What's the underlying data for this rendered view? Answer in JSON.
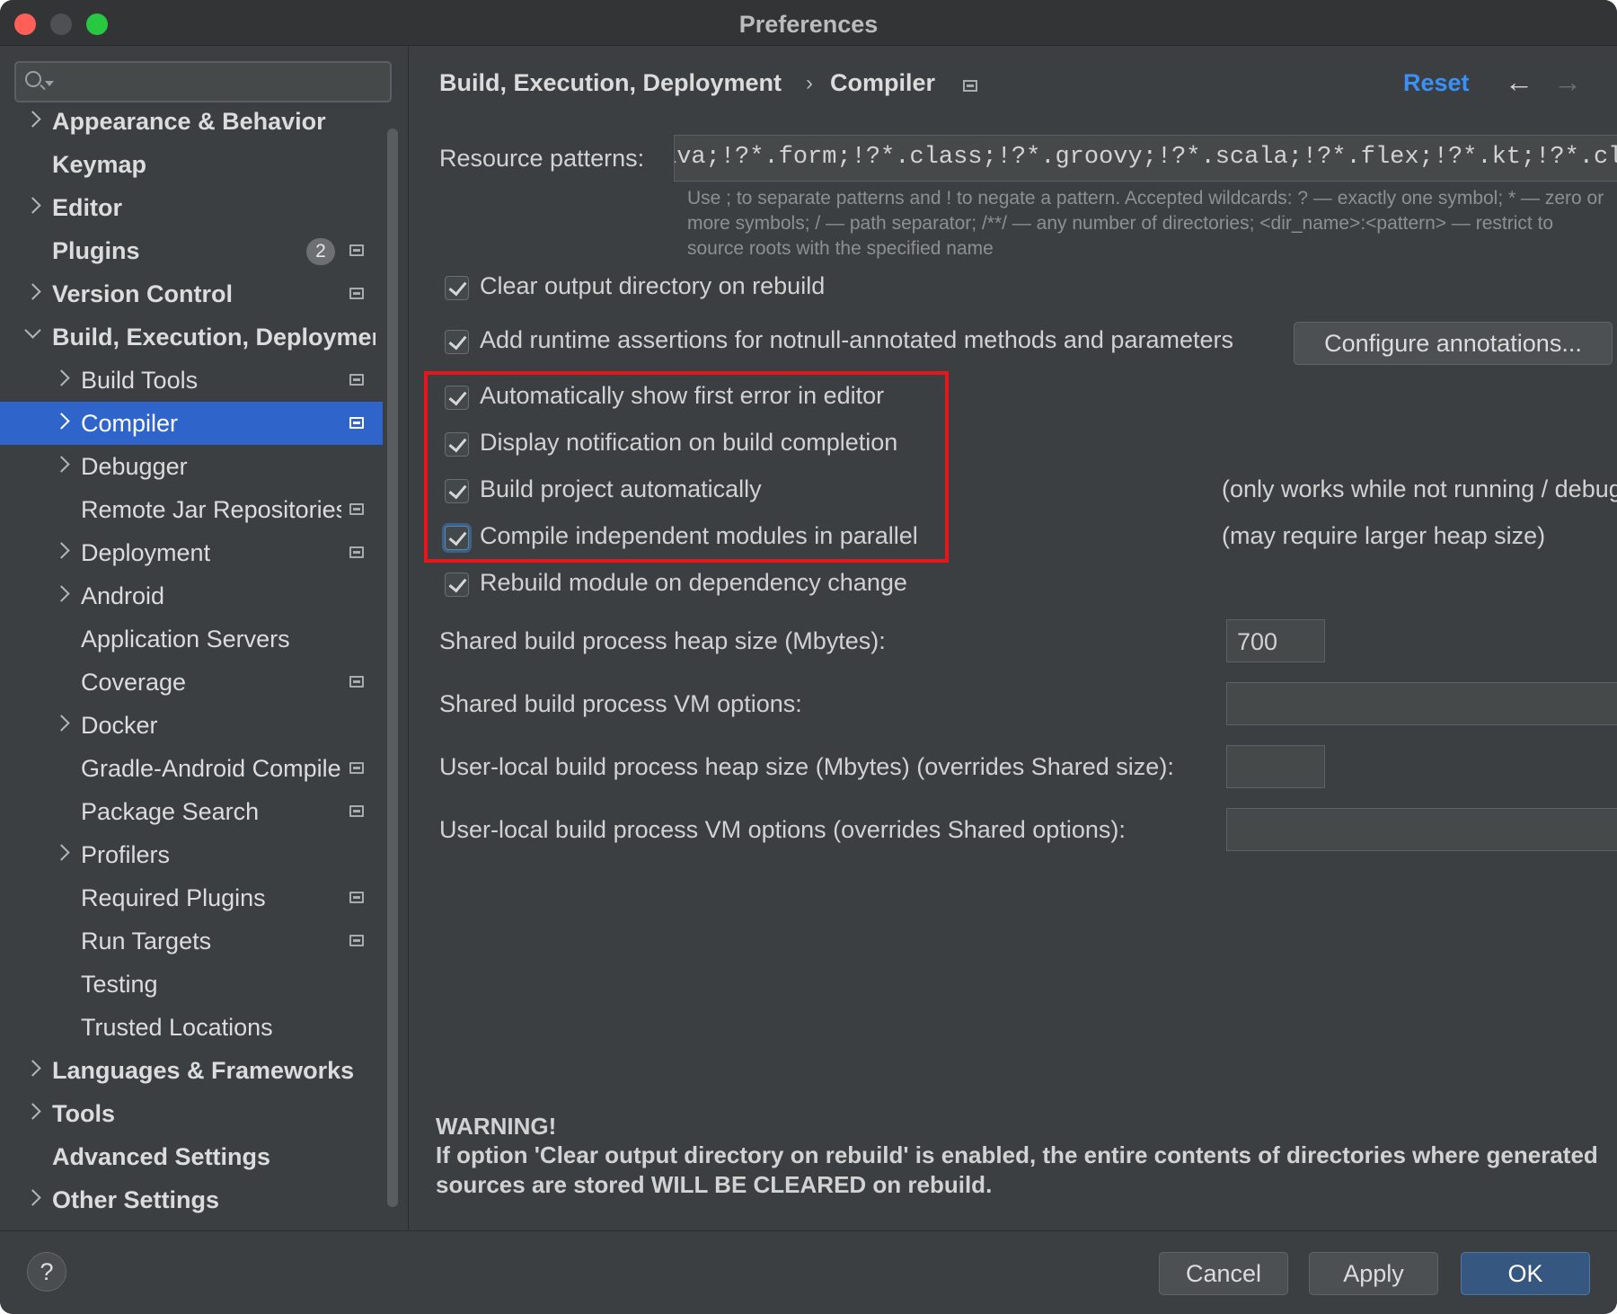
{
  "window": {
    "title": "Preferences"
  },
  "search": {
    "placeholder": ""
  },
  "sidebar": {
    "items": [
      {
        "label": "Appearance & Behavior",
        "expandable": "collapsed",
        "bold": true,
        "badge": "",
        "project_icon": false,
        "selected": false
      },
      {
        "label": "Keymap",
        "expandable": "none",
        "bold": true,
        "badge": "",
        "project_icon": false,
        "selected": false
      },
      {
        "label": "Editor",
        "expandable": "collapsed",
        "bold": true,
        "badge": "",
        "project_icon": false,
        "selected": false
      },
      {
        "label": "Plugins",
        "expandable": "none",
        "bold": true,
        "badge": "2",
        "project_icon": true,
        "selected": false
      },
      {
        "label": "Version Control",
        "expandable": "collapsed",
        "bold": true,
        "badge": "",
        "project_icon": true,
        "selected": false
      },
      {
        "label": "Build, Execution, Deployment",
        "expandable": "expanded",
        "bold": true,
        "badge": "",
        "project_icon": false,
        "selected": false
      },
      {
        "label": "Build Tools",
        "expandable": "collapsed",
        "bold": false,
        "badge": "",
        "project_icon": true,
        "selected": false
      },
      {
        "label": "Compiler",
        "expandable": "collapsed",
        "bold": false,
        "badge": "",
        "project_icon": true,
        "selected": true
      },
      {
        "label": "Debugger",
        "expandable": "collapsed",
        "bold": false,
        "badge": "",
        "project_icon": false,
        "selected": false
      },
      {
        "label": "Remote Jar Repositories",
        "expandable": "none",
        "bold": false,
        "badge": "",
        "project_icon": true,
        "selected": false
      },
      {
        "label": "Deployment",
        "expandable": "collapsed",
        "bold": false,
        "badge": "",
        "project_icon": true,
        "selected": false
      },
      {
        "label": "Android",
        "expandable": "collapsed",
        "bold": false,
        "badge": "",
        "project_icon": false,
        "selected": false
      },
      {
        "label": "Application Servers",
        "expandable": "none",
        "bold": false,
        "badge": "",
        "project_icon": false,
        "selected": false
      },
      {
        "label": "Coverage",
        "expandable": "none",
        "bold": false,
        "badge": "",
        "project_icon": true,
        "selected": false
      },
      {
        "label": "Docker",
        "expandable": "collapsed",
        "bold": false,
        "badge": "",
        "project_icon": false,
        "selected": false
      },
      {
        "label": "Gradle-Android Compiler",
        "expandable": "none",
        "bold": false,
        "badge": "",
        "project_icon": true,
        "selected": false
      },
      {
        "label": "Package Search",
        "expandable": "none",
        "bold": false,
        "badge": "",
        "project_icon": true,
        "selected": false
      },
      {
        "label": "Profilers",
        "expandable": "collapsed",
        "bold": false,
        "badge": "",
        "project_icon": false,
        "selected": false
      },
      {
        "label": "Required Plugins",
        "expandable": "none",
        "bold": false,
        "badge": "",
        "project_icon": true,
        "selected": false
      },
      {
        "label": "Run Targets",
        "expandable": "none",
        "bold": false,
        "badge": "",
        "project_icon": true,
        "selected": false
      },
      {
        "label": "Testing",
        "expandable": "none",
        "bold": false,
        "badge": "",
        "project_icon": false,
        "selected": false
      },
      {
        "label": "Trusted Locations",
        "expandable": "none",
        "bold": false,
        "badge": "",
        "project_icon": false,
        "selected": false
      },
      {
        "label": "Languages & Frameworks",
        "expandable": "collapsed",
        "bold": true,
        "badge": "",
        "project_icon": false,
        "selected": false
      },
      {
        "label": "Tools",
        "expandable": "collapsed",
        "bold": true,
        "badge": "",
        "project_icon": false,
        "selected": false
      },
      {
        "label": "Advanced Settings",
        "expandable": "none",
        "bold": true,
        "badge": "",
        "project_icon": false,
        "selected": false
      },
      {
        "label": "Other Settings",
        "expandable": "collapsed",
        "bold": true,
        "badge": "",
        "project_icon": false,
        "selected": false
      }
    ]
  },
  "header": {
    "breadcrumb_parent": "Build, Execution, Deployment",
    "breadcrumb_separator": "›",
    "breadcrumb_current": "Compiler",
    "reset_label": "Reset",
    "back_icon": "←",
    "forward_icon": "→"
  },
  "compiler": {
    "resource_patterns_label": "Resource patterns:",
    "resource_patterns_value": "!?*.java;!?*.form;!?*.class;!?*.groovy;!?*.scala;!?*.flex;!?*.kt;!?*.clj;!?*.aj",
    "hint_line1": "Use ; to separate patterns and ! to negate a pattern. Accepted wildcards: ? — exactly one symbol; * — zero or",
    "hint_line2": "more symbols; / — path separator; /**/ — any number of directories; <dir_name>:<pattern> — restrict to",
    "hint_line3": "source roots with the specified name",
    "options": [
      {
        "label": "Clear output directory on rebuild",
        "checked": true,
        "note": ""
      },
      {
        "label": "Add runtime assertions for notnull-annotated methods and parameters",
        "checked": true,
        "note": ""
      },
      {
        "label": "Automatically show first error in editor",
        "checked": true,
        "note": ""
      },
      {
        "label": "Display notification on build completion",
        "checked": true,
        "note": ""
      },
      {
        "label": "Build project automatically",
        "checked": true,
        "note": "(only works while not running / debugging)"
      },
      {
        "label": "Compile independent modules in parallel",
        "checked": true,
        "note": "(may require larger heap size)"
      },
      {
        "label": "Rebuild module on dependency change",
        "checked": true,
        "note": ""
      }
    ],
    "configure_annotations_label": "Configure annotations...",
    "shared_heap_label": "Shared build process heap size (Mbytes):",
    "shared_heap_value": "700",
    "shared_vm_label": "Shared build process VM options:",
    "shared_vm_value": "",
    "user_heap_label": "User-local build process heap size (Mbytes) (overrides Shared size):",
    "user_heap_value": "",
    "user_vm_label": "User-local build process VM options (overrides Shared options):",
    "user_vm_value": "",
    "warning_title": "WARNING!",
    "warning_text": "If option 'Clear output directory on rebuild' is enabled, the entire contents of directories where generated sources are stored WILL BE CLEARED on rebuild."
  },
  "footer": {
    "help_label": "?",
    "cancel_label": "Cancel",
    "apply_label": "Apply",
    "ok_label": "OK"
  },
  "colors": {
    "selection": "#2f65ca",
    "accent_link": "#3b8ff5",
    "highlight_box": "#e8151c",
    "primary_button": "#365880"
  }
}
